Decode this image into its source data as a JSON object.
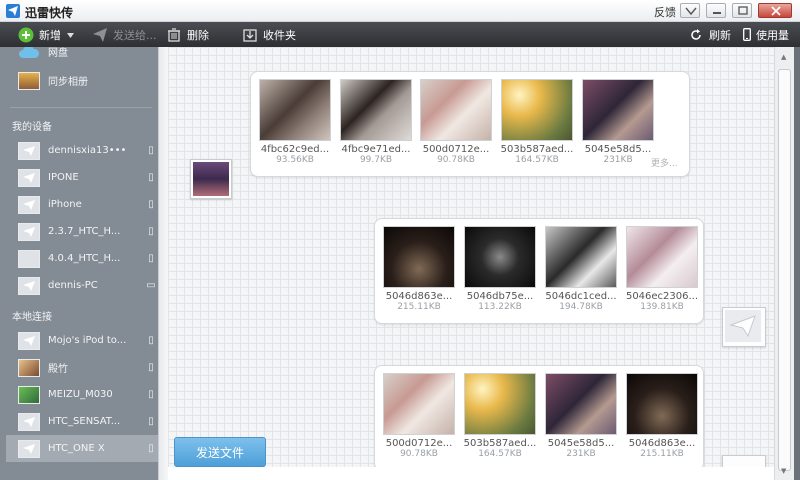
{
  "window": {
    "title": "迅雷快传",
    "feedback": "反馈"
  },
  "toolbar": {
    "new_label": "新增",
    "send_to_label": "发送给...",
    "delete_label": "删除",
    "favorites_label": "收件夹",
    "refresh_label": "刷新",
    "usage_label": "使用量"
  },
  "sidebar": {
    "top_items": [
      {
        "label": "网盘",
        "icon": "cloud-icon"
      },
      {
        "label": "同步相册",
        "icon": "album-icon"
      }
    ],
    "my_devices_heading": "我的设备",
    "my_devices": [
      {
        "label": "dennisxia13•••",
        "device": "phone"
      },
      {
        "label": "IPONE",
        "device": "phone"
      },
      {
        "label": "iPhone",
        "device": "phone"
      },
      {
        "label": "2.3.7_HTC_H...",
        "device": "phone"
      },
      {
        "label": "4.0.4_HTC_H...",
        "device": "phone"
      },
      {
        "label": "dennis-PC",
        "device": "pc"
      }
    ],
    "local_heading": "本地连接",
    "local_devices": [
      {
        "label": "Mojo's iPod to...",
        "device": "phone"
      },
      {
        "label": "殿竹",
        "device": "phone"
      },
      {
        "label": "MEIZU_M030",
        "device": "phone"
      },
      {
        "label": "HTC_SENSAT...",
        "device": "phone"
      },
      {
        "label": "HTC_ONE X",
        "device": "phone",
        "selected": true
      }
    ]
  },
  "conversation": [
    {
      "direction": "received",
      "files": [
        {
          "name": "4fbc62c9ed...",
          "size": "93.56KB"
        },
        {
          "name": "4fbc9e71ed...",
          "size": "99.7KB"
        },
        {
          "name": "500d0712e...",
          "size": "90.78KB"
        },
        {
          "name": "503b587aed...",
          "size": "164.57KB"
        },
        {
          "name": "5045e58d5...",
          "size": "231KB"
        }
      ],
      "more_label": "更多..."
    },
    {
      "direction": "sent",
      "files": [
        {
          "name": "5046d863e...",
          "size": "215.11KB"
        },
        {
          "name": "5046db75e...",
          "size": "113.22KB"
        },
        {
          "name": "5046dc1ced...",
          "size": "194.78KB"
        },
        {
          "name": "5046ec2306...",
          "size": "139.81KB"
        }
      ]
    },
    {
      "direction": "sent",
      "files": [
        {
          "name": "500d0712e...",
          "size": "90.78KB"
        },
        {
          "name": "503b587aed...",
          "size": "164.57KB"
        },
        {
          "name": "5045e58d5...",
          "size": "231KB"
        },
        {
          "name": "5046d863e...",
          "size": "215.11KB"
        }
      ]
    }
  ],
  "send_button_label": "发送文件",
  "colors": {
    "toolbar": "#2d2f33",
    "sidebar": "#838b94",
    "accent": "#4d9fd8"
  }
}
